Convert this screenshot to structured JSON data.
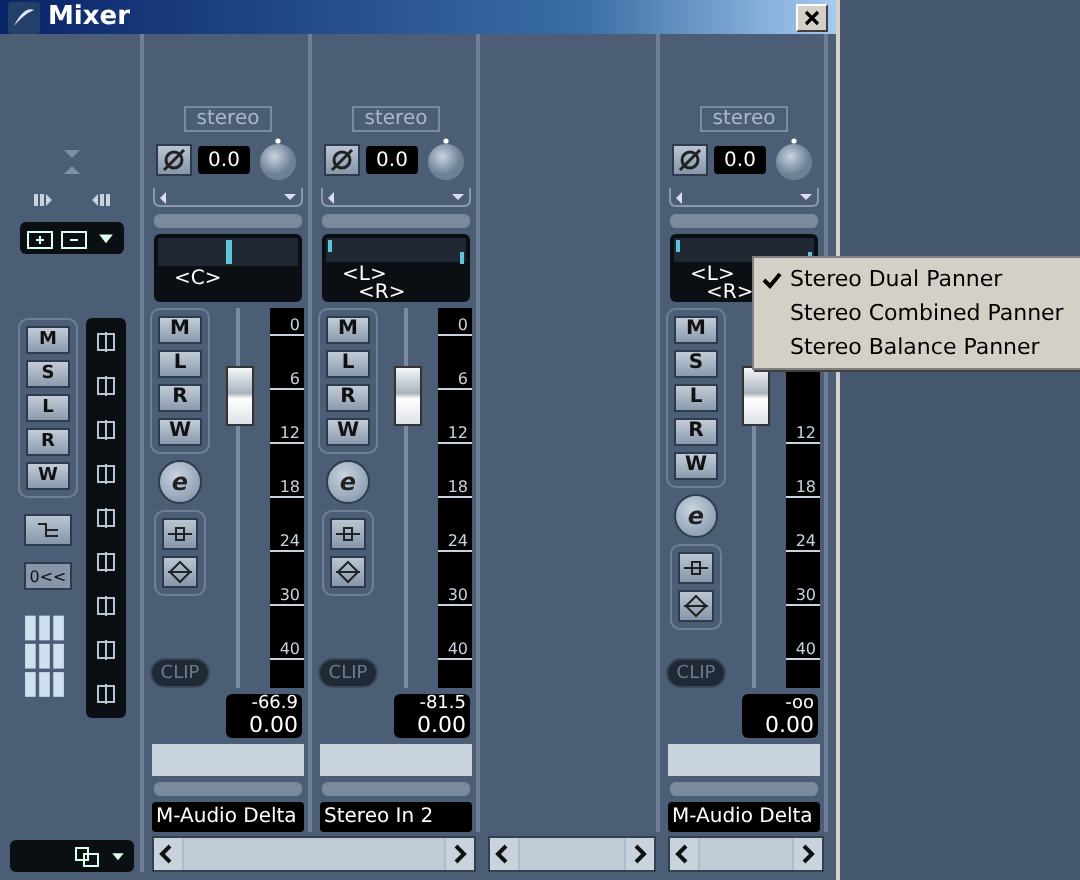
{
  "window": {
    "title": "Mixer"
  },
  "left_panel": {
    "mode_buttons": [
      {
        "label": "M"
      },
      {
        "label": "S"
      },
      {
        "label": "L"
      },
      {
        "label": "R"
      },
      {
        "label": "W"
      }
    ],
    "reset_button": "0<<"
  },
  "channels": [
    {
      "input_label": "stereo",
      "gain": "0.0",
      "pan_labels": [
        "<C>"
      ],
      "buttons": [
        "M",
        "L",
        "R",
        "W"
      ],
      "scale": [
        "0",
        "6",
        "12",
        "18",
        "24",
        "30",
        "40"
      ],
      "edit": "e",
      "fader": {
        "level": 0.82
      },
      "clip": "CLIP",
      "peak": "-66.9",
      "volume": "0.00",
      "name": "M-Audio Delta"
    },
    {
      "input_label": "stereo",
      "gain": "0.0",
      "pan_labels": [
        "<L>",
        "<R>"
      ],
      "buttons": [
        "M",
        "L",
        "R",
        "W"
      ],
      "scale": [
        "0",
        "6",
        "12",
        "18",
        "24",
        "30",
        "40"
      ],
      "edit": "e",
      "fader": {
        "level": 0.82
      },
      "clip": "CLIP",
      "peak": "-81.5",
      "volume": "0.00",
      "name": "Stereo In 2"
    },
    {
      "input_label": "stereo",
      "gain": "0.0",
      "pan_labels": [
        "<L>",
        "<R>"
      ],
      "buttons": [
        "M",
        "S",
        "L",
        "R",
        "W"
      ],
      "scale": [
        "12",
        "18",
        "24",
        "30",
        "40"
      ],
      "edit": "e",
      "fader": {
        "level": 0.82
      },
      "clip": "CLIP",
      "peak": "-oo",
      "volume": "0.00",
      "name": "M-Audio Delta"
    }
  ],
  "panner_menu": [
    {
      "label": "Stereo Dual Panner",
      "checked": true
    },
    {
      "label": "Stereo Combined Panner",
      "checked": false
    },
    {
      "label": "Stereo Balance Panner",
      "checked": false
    }
  ]
}
